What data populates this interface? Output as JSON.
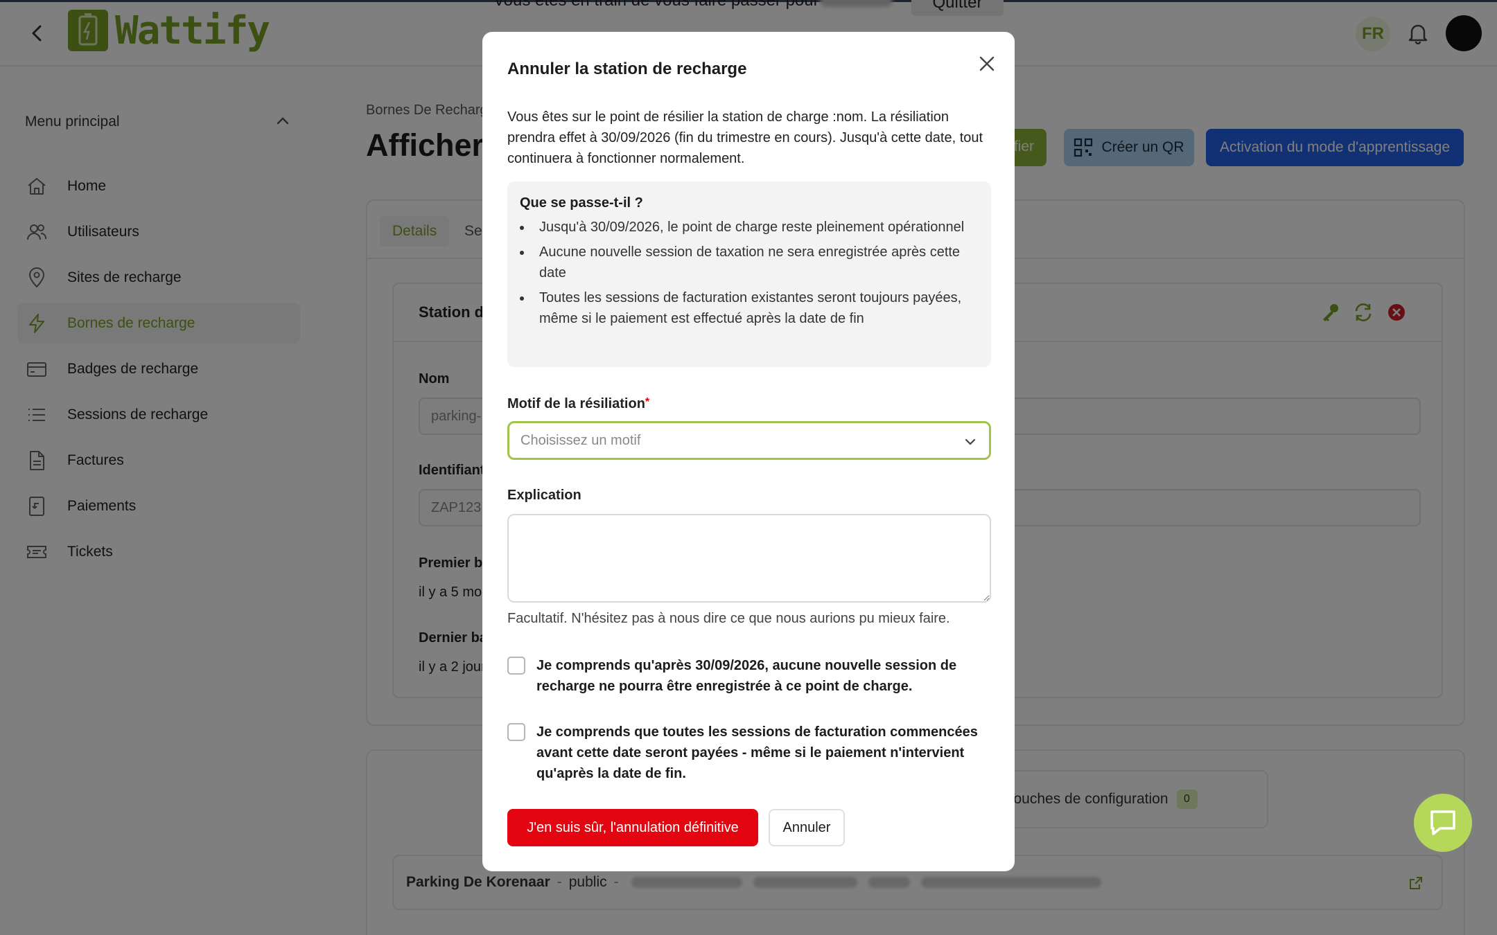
{
  "impersonation": {
    "message": "Vous êtes en train de vous faire passer pour",
    "quit_label": "Quitter"
  },
  "header": {
    "logo": "Wattify",
    "language": "FR"
  },
  "sidebar": {
    "title": "Menu principal",
    "items": [
      {
        "label": "Home",
        "icon": "home-icon"
      },
      {
        "label": "Utilisateurs",
        "icon": "users-icon"
      },
      {
        "label": "Sites de recharge",
        "icon": "map-pin-icon"
      },
      {
        "label": "Bornes de recharge",
        "icon": "bolt-icon",
        "active": true
      },
      {
        "label": "Badges de recharge",
        "icon": "card-icon"
      },
      {
        "label": "Sessions de recharge",
        "icon": "list-icon"
      },
      {
        "label": "Factures",
        "icon": "document-icon"
      },
      {
        "label": "Paiements",
        "icon": "receipt-icon"
      },
      {
        "label": "Tickets",
        "icon": "ticket-icon"
      }
    ]
  },
  "main": {
    "breadcrumb": "Bornes De Recharge",
    "title": "Afficher",
    "modify_label": "Modifier",
    "qr_label": "Créer un QR",
    "learn_label": "Activation du mode d'apprentissage",
    "tabs": [
      "Details",
      "Se"
    ],
    "station_title": "Station d",
    "fields": {
      "nom_label": "Nom",
      "nom_value": "parking-",
      "id_label": "Identifiant",
      "id_value": "ZAP123",
      "premier_label": "Premier ba",
      "premier_value": "il y a 5 mo",
      "dernier_label": "Dernier ba",
      "dernier_value": "il y a 2 jour"
    },
    "config_tab": {
      "label": "Touches de configuration",
      "count": "0"
    },
    "parking": {
      "name": "Parking De Korenaar",
      "visibility": "public"
    }
  },
  "modal": {
    "title": "Annuler la station de recharge",
    "intro": "Vous êtes sur le point de résilier la station de charge :nom. La résiliation prendra effet à 30/09/2026 (fin du trimestre en cours). Jusqu'à cette date, tout continuera à fonctionner normalement.",
    "box_title": "Que se passe-t-il ?",
    "bullets": [
      "Jusqu'à 30/09/2026, le point de charge reste pleinement opérationnel",
      "Aucune nouvelle session de taxation ne sera enregistrée après cette date",
      "Toutes les sessions de facturation existantes seront toujours payées, même si le paiement est effectué après la date de fin"
    ],
    "reason_label": "Motif de la résiliation",
    "reason_required": "*",
    "reason_placeholder": "Choisissez un motif",
    "explanation_label": "Explication",
    "explanation_value": "",
    "explanation_help": "Facultatif. N'hésitez pas à nous dire ce que nous aurions pu mieux faire.",
    "check1": "Je comprends qu'après 30/09/2026, aucune nouvelle session de recharge ne pourra être enregistrée à ce point de charge.",
    "check2": "Je comprends que toutes les sessions de facturation commencées avant cette date seront payées - même si le paiement n'intervient qu'après la date de fin.",
    "confirm_label": "J'en suis sûr, l'annulation définitive",
    "cancel_label": "Annuler"
  },
  "colors": {
    "brand": "#7ba127",
    "danger": "#e30611",
    "primary": "#2563eb",
    "qr": "#a9d0f0"
  }
}
